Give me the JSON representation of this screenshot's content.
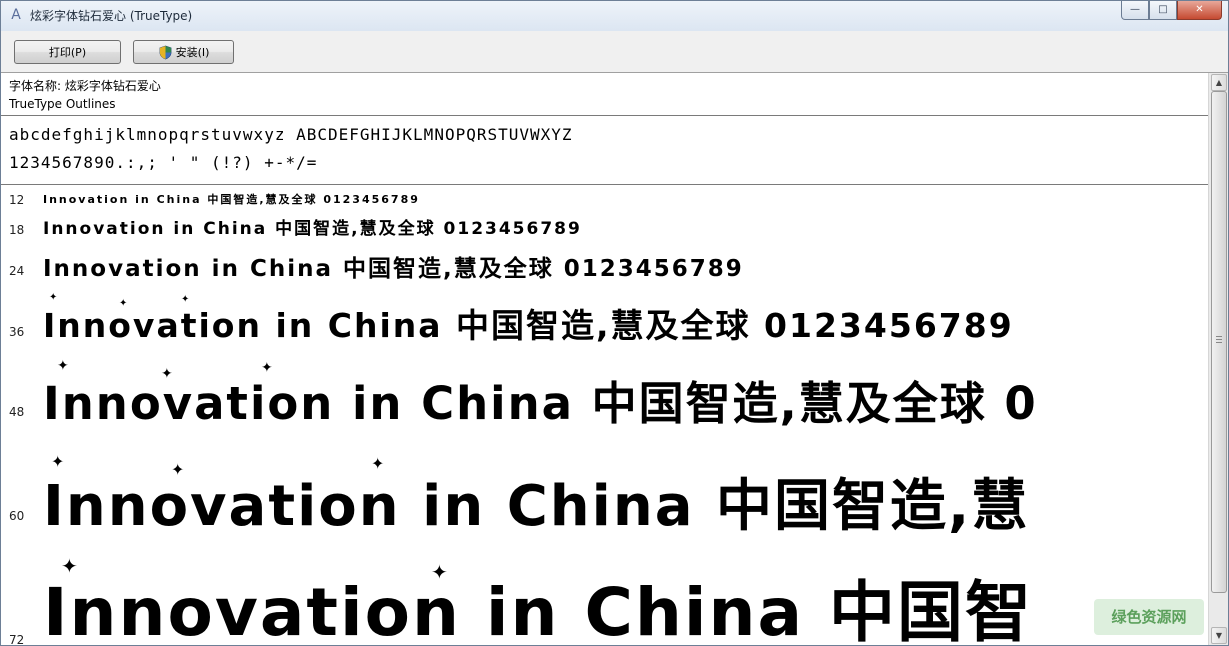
{
  "window": {
    "title": "炫彩字体钻石爱心 (TrueType)",
    "caption_min": "—",
    "caption_max": "□",
    "caption_close": "✕"
  },
  "toolbar": {
    "print_label": "打印(P)",
    "install_label": "安装(I)"
  },
  "font_info": {
    "name_line": "字体名称: 炫彩字体钻石爱心",
    "type_line": "TrueType Outlines"
  },
  "charset": {
    "line1": "abcdefghijklmnopqrstuvwxyz ABCDEFGHIJKLMNOPQRSTUVWXYZ",
    "line2": "1234567890.:,; ' \" (!?) +-*/="
  },
  "samples": [
    {
      "size": "12",
      "text": "Innovation in China 中国智造,慧及全球 0123456789"
    },
    {
      "size": "18",
      "text": "Innovation in China 中国智造,慧及全球 0123456789"
    },
    {
      "size": "24",
      "text": "Innovation in China 中国智造,慧及全球 0123456789"
    },
    {
      "size": "36",
      "text": "Innovation in China 中国智造,慧及全球 0123456789"
    },
    {
      "size": "48",
      "text": "Innovation in China 中国智造,慧及全球 0"
    },
    {
      "size": "60",
      "text": "Innovation in China 中国智造,慧"
    },
    {
      "size": "72",
      "text": "Innovation in China 中国智"
    }
  ],
  "watermark": "绿色资源网",
  "colors": {
    "title_bg": "#dce6f2",
    "close_btn": "#c54a31",
    "toolbar_bg": "#f0f0f0"
  }
}
